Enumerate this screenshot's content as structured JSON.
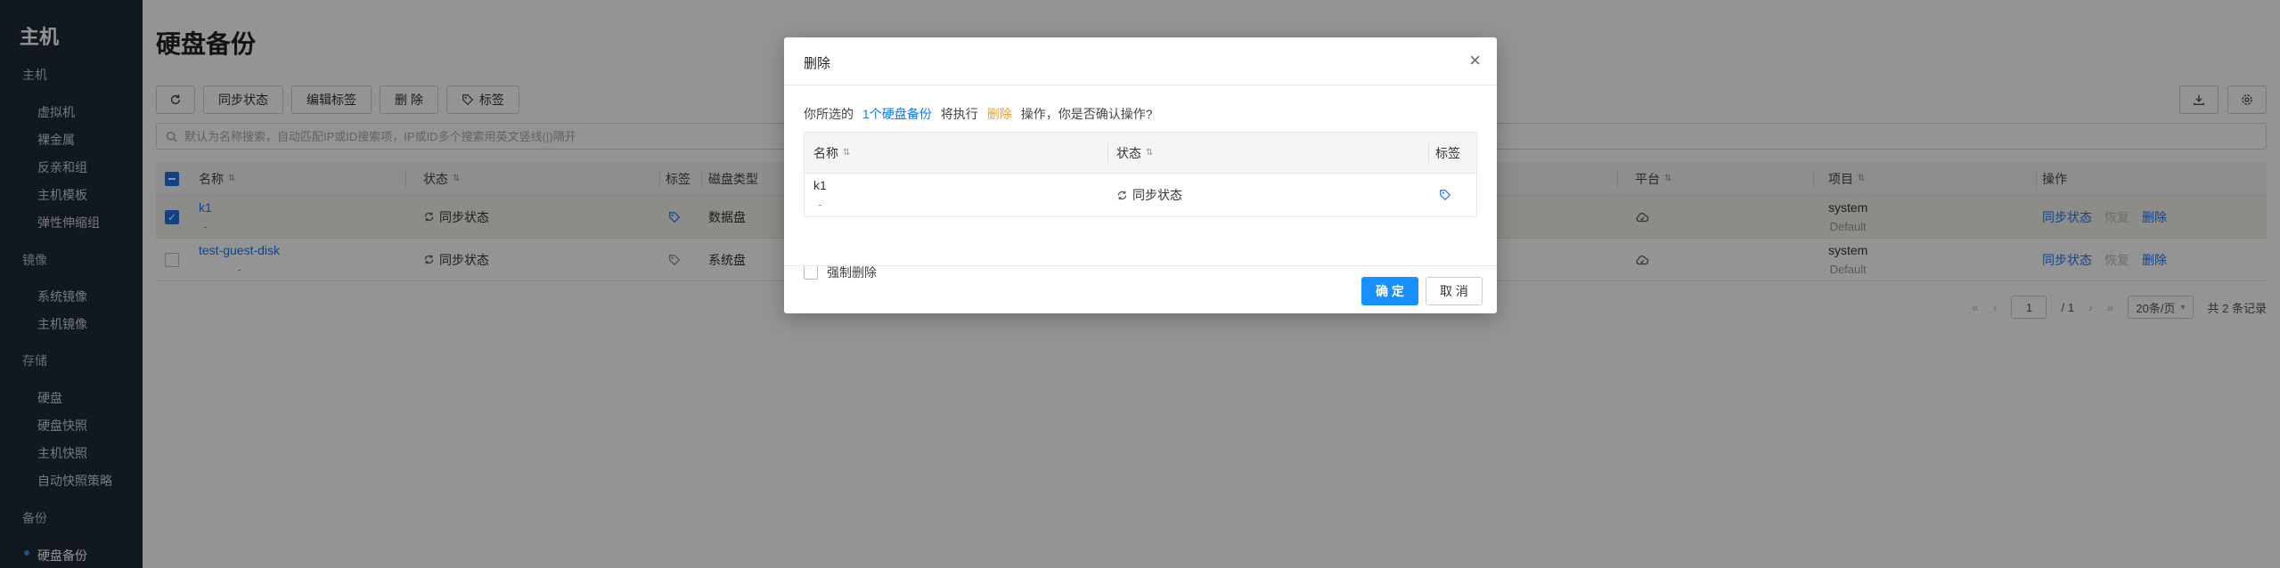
{
  "sidebar": {
    "app_title": "主机",
    "groups": [
      {
        "label": "主机"
      },
      {
        "label": "镜像"
      },
      {
        "label": "存储"
      },
      {
        "label": "备份"
      }
    ],
    "items": [
      {
        "label": "虚拟机"
      },
      {
        "label": "裸金属"
      },
      {
        "label": "反亲和组"
      },
      {
        "label": "主机模板"
      },
      {
        "label": "弹性伸缩组"
      },
      {
        "label": "系统镜像"
      },
      {
        "label": "主机镜像"
      },
      {
        "label": "硬盘"
      },
      {
        "label": "硬盘快照"
      },
      {
        "label": "主机快照"
      },
      {
        "label": "自动快照策略"
      },
      {
        "label": "硬盘备份"
      }
    ]
  },
  "page": {
    "title": "硬盘备份"
  },
  "toolbar": {
    "sync_label": "同步状态",
    "edit_tags_label": "编辑标签",
    "delete_label": "删 除",
    "tags_label": "标签"
  },
  "search": {
    "placeholder": "默认为名称搜索，自动匹配IP或ID搜索项，IP或ID多个搜索用英文竖线(|)隔开"
  },
  "table": {
    "headers": {
      "name": "名称",
      "status": "状态",
      "tag": "标签",
      "disk_type": "磁盘类型",
      "platform": "平台",
      "project": "项目",
      "ops": "操作"
    },
    "rows": [
      {
        "name": "k1",
        "sub": "-",
        "status": "同步状态",
        "disk_type": "数据盘",
        "project": "system",
        "project_sub": "Default",
        "op_sync": "同步状态",
        "op_restore": "恢复",
        "op_delete": "删除"
      },
      {
        "name": "test-guest-disk",
        "sub": "-",
        "status": "同步状态",
        "disk_type": "系统盘",
        "project": "system",
        "project_sub": "Default",
        "op_sync": "同步状态",
        "op_restore": "恢复",
        "op_delete": "删除"
      }
    ]
  },
  "pager": {
    "page": "1",
    "total_pages": "/ 1",
    "page_size": "20条/页",
    "total": "共 2 条记录"
  },
  "modal": {
    "title": "删除",
    "prefix": "你所选的",
    "count": "1个硬盘备份",
    "will": "将执行",
    "action": "删除",
    "suffix": "操作，你是否确认操作?",
    "headers": {
      "name": "名称",
      "status": "状态",
      "tag": "标签"
    },
    "row": {
      "name": "k1",
      "sub": "-",
      "status": "同步状态"
    },
    "force_label": "强制删除",
    "ok_label": "确 定",
    "cancel_label": "取 消"
  }
}
